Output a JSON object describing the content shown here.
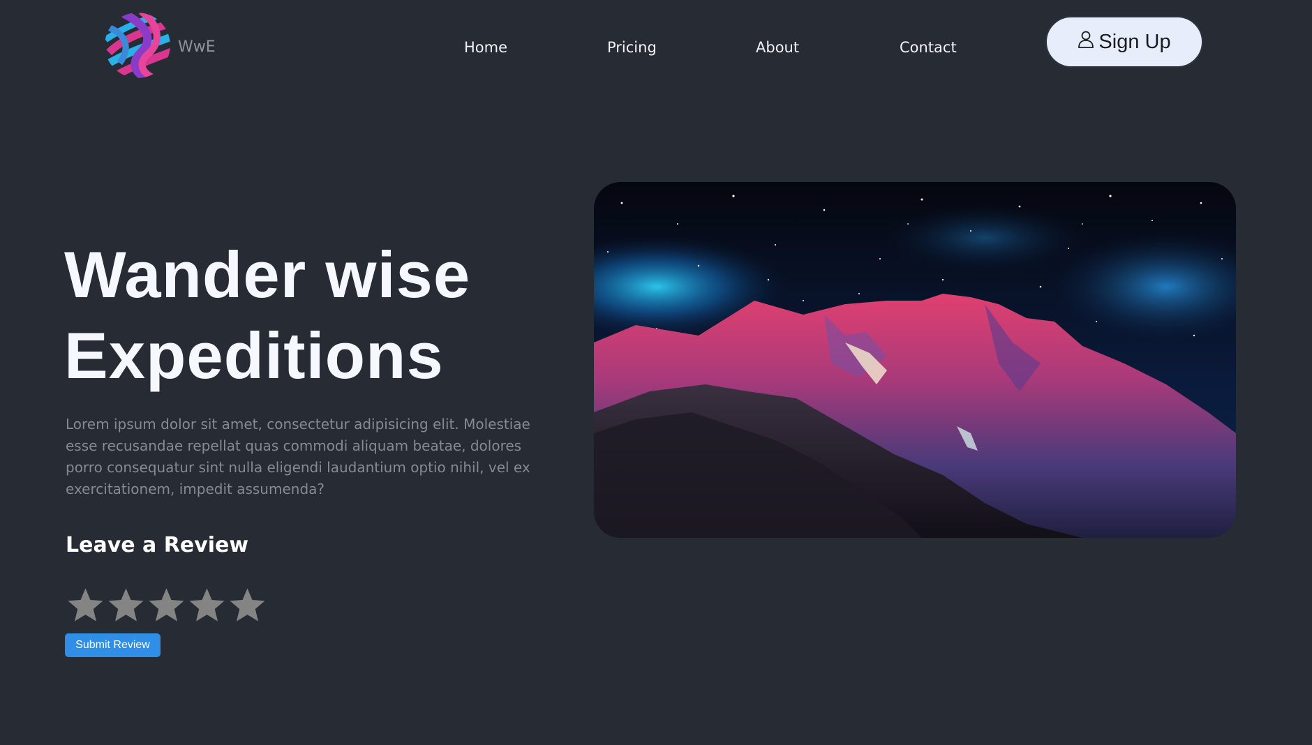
{
  "header": {
    "logo_text": "WwE",
    "nav": [
      {
        "label": "Home"
      },
      {
        "label": "Pricing"
      },
      {
        "label": "About"
      },
      {
        "label": "Contact"
      }
    ],
    "signup_label": "Sign Up",
    "signup_icon": "user-icon"
  },
  "hero": {
    "title_line1": "Wander wise",
    "title_line2": "Expeditions",
    "description": "Lorem ipsum dolor sit amet, consectetur adipisicing elit. Molestiae esse recusandae repellat quas commodi aliquam beatae, dolores porro consequatur sint nulla eligendi laudantium optio nihil, vel ex exercitationem, impedit assumenda?",
    "image": "mountain-night-sky-image"
  },
  "review": {
    "heading": "Leave a Review",
    "rating": 0,
    "max_rating": 5,
    "submit_label": "Submit Review"
  },
  "colors": {
    "background": "#272b34",
    "signup_bg": "#e8edfb",
    "submit_bg": "#2f8ee6",
    "star": "#848484"
  }
}
